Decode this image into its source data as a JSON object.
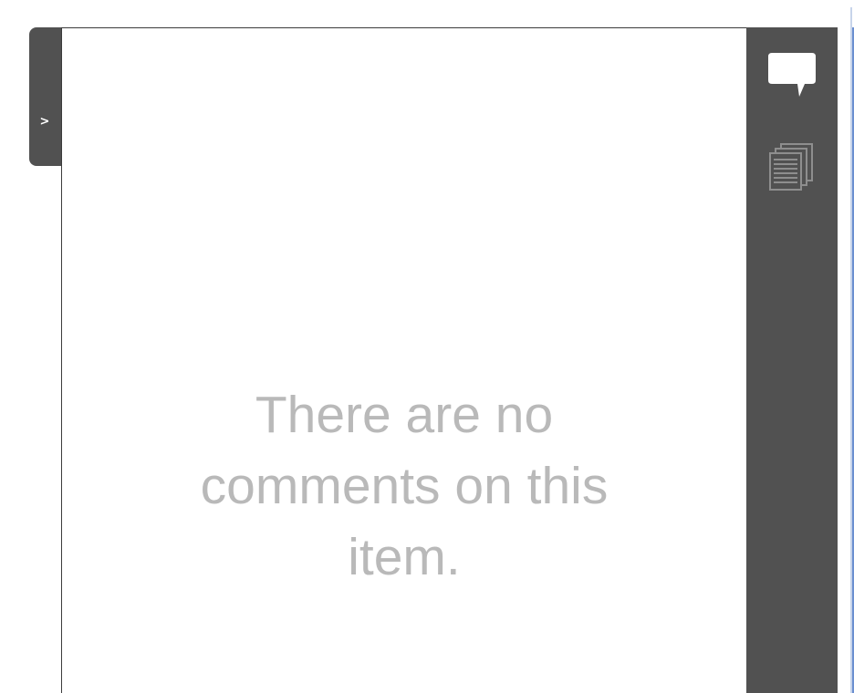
{
  "collapse_tab": {
    "chevron": ">"
  },
  "comments_panel": {
    "empty_message": "There are no comments on this item."
  },
  "toolbar": {
    "buttons": [
      {
        "icon": "comment-bubble-icon",
        "active": true
      },
      {
        "icon": "stacked-pages-icon",
        "active": false
      }
    ]
  },
  "colors": {
    "toolbar_bg": "#515151",
    "panel_bg": "#ffffff",
    "empty_text": "#b9b9b9",
    "active_icon": "#ffffff",
    "inactive_icon": "#8e8e8e"
  }
}
